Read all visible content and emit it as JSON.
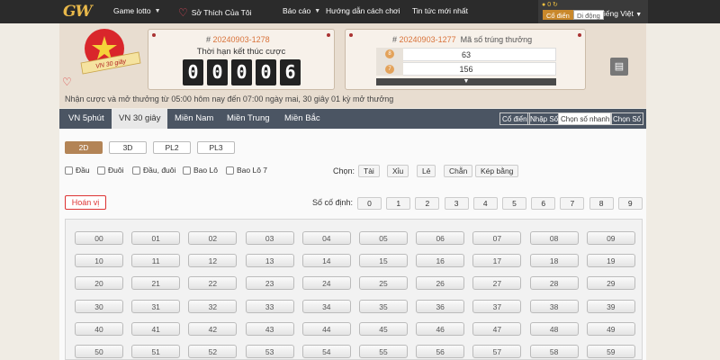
{
  "nav": {
    "logo": "GW",
    "items": [
      {
        "label": "Game lotto",
        "chevron": true
      },
      {
        "label": "Sở Thích Của Tôi",
        "chevron": false
      },
      {
        "label": "Báo cáo",
        "chevron": true
      },
      {
        "label": "Hướng dẫn cách chơi",
        "chevron": false
      },
      {
        "label": "Tin tức mới nhất",
        "chevron": false
      }
    ],
    "user_count": "0",
    "mode_classic": "Cổ điển",
    "mode_mobile": "Di động",
    "language": "Tiếng Việt"
  },
  "badge": {
    "text": "VN 30 giây"
  },
  "timer_panel": {
    "draw_prefix": "#",
    "draw_id": "20240903-1278",
    "label": "Thời hạn kết thúc cược",
    "digits": [
      "0",
      "0",
      "0",
      "0",
      "6"
    ]
  },
  "result_panel": {
    "draw_prefix": "#",
    "draw_id": "20240903-1277",
    "label": "Mã số trúng thưởng",
    "rows": [
      {
        "ball": "8",
        "value": "63"
      },
      {
        "ball": "7",
        "value": "156"
      }
    ]
  },
  "notice": "Nhận cược và mở thưởng từ 05:00 hôm nay đến 07:00 ngày mai,    30 giây 01 kỳ mở thưởng",
  "tabs": [
    {
      "label": "VN 5phút",
      "active": false
    },
    {
      "label": "VN 30 giây",
      "active": true
    },
    {
      "label": "Miền Nam",
      "active": false
    },
    {
      "label": "Miền Trung",
      "active": false
    },
    {
      "label": "Miền Bắc",
      "active": false
    }
  ],
  "subtabs": [
    {
      "label": "Cổ điển",
      "active": false
    },
    {
      "label": "Nhập Số",
      "active": false
    },
    {
      "label": "Chọn số nhanh",
      "active": true
    },
    {
      "label": "Chọn Số",
      "active": false
    }
  ],
  "types": [
    {
      "label": "2D",
      "active": true
    },
    {
      "label": "3D",
      "active": false
    },
    {
      "label": "PL2",
      "active": false
    },
    {
      "label": "PL3",
      "active": false
    }
  ],
  "checkboxes": [
    "Đầu",
    "Đuôi",
    "Đầu, đuôi",
    "Bao Lô",
    "Bao Lô 7"
  ],
  "chon": {
    "label": "Chọn:",
    "options": [
      "Tài",
      "Xỉu",
      "Lẻ",
      "Chẵn",
      "Kép bằng"
    ]
  },
  "hoanvi": "Hoán vị",
  "so_co_dinh": {
    "label": "Số cố định:",
    "digits": [
      "0",
      "1",
      "2",
      "3",
      "4",
      "5",
      "6",
      "7",
      "8",
      "9"
    ]
  },
  "numbers": [
    "00",
    "01",
    "02",
    "03",
    "04",
    "05",
    "06",
    "07",
    "08",
    "09",
    "10",
    "11",
    "12",
    "13",
    "14",
    "15",
    "16",
    "17",
    "18",
    "19",
    "20",
    "21",
    "22",
    "23",
    "24",
    "25",
    "26",
    "27",
    "28",
    "29",
    "30",
    "31",
    "32",
    "33",
    "34",
    "35",
    "36",
    "37",
    "38",
    "39",
    "40",
    "41",
    "42",
    "43",
    "44",
    "45",
    "46",
    "47",
    "48",
    "49",
    "50",
    "51",
    "52",
    "53",
    "54",
    "55",
    "56",
    "57",
    "58",
    "59"
  ],
  "colors": {
    "accent": "#b38456",
    "nav_bg": "#2b2b2b",
    "tab_bg": "#4b5563",
    "draw_id": "#d9733a",
    "badge_red": "#d9262b"
  }
}
